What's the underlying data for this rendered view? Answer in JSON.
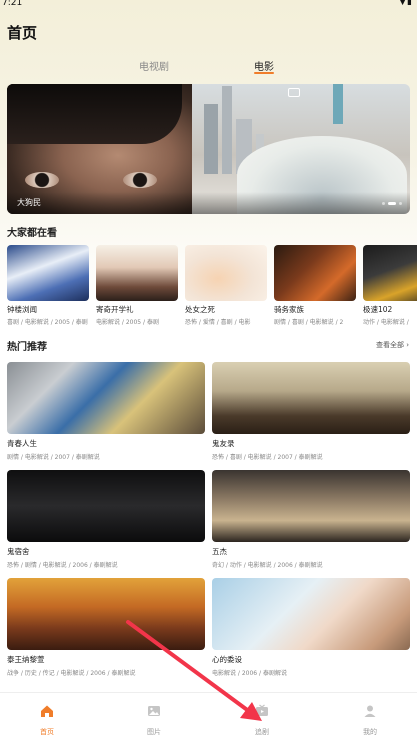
{
  "status": {
    "time": "7:21",
    "icons": "▼▮"
  },
  "page_title": "首页",
  "tabs": [
    {
      "label": "电视剧",
      "active": false
    },
    {
      "label": "电影",
      "active": true
    }
  ],
  "banner": {
    "caption": "大狗民"
  },
  "section_popular": {
    "title": "大家都在看"
  },
  "popular": [
    {
      "name": "钟楼浏闻",
      "meta": "喜剧 / 电影解说 / 2005 / 泰剧"
    },
    {
      "name": "寄奇开学礼",
      "meta": "电影解说 / 2005 / 泰剧"
    },
    {
      "name": "处女之死",
      "meta": "恐怖 / 爱情 / 喜剧 / 电影"
    },
    {
      "name": "骑务家族",
      "meta": "剧情 / 喜剧 / 电影解说 / 2"
    },
    {
      "name": "极速102",
      "meta": "动作 / 电影解说 /"
    }
  ],
  "section_hot": {
    "title": "热门推荐",
    "more": "查看全部"
  },
  "hot": [
    {
      "name": "青春人生",
      "meta": "剧情 / 电影解说 / 2007 / 泰剧解说"
    },
    {
      "name": "鬼友录",
      "meta": "恐怖 / 喜剧 / 电影解说 / 2007 / 泰剧解说"
    },
    {
      "name": "鬼宿舍",
      "meta": "恐怖 / 剧情 / 电影解说 / 2006 / 泰剧解说"
    },
    {
      "name": "五杰",
      "meta": "奇幻 / 动作 / 电影解说 / 2006 / 泰剧解说"
    },
    {
      "name": "泰王纳黎萱",
      "meta": "战争 / 历史 / 传记 / 电影解说 / 2006 / 泰剧解说"
    },
    {
      "name": "心的委设",
      "meta": "电影解说 / 2006 / 泰剧解说"
    }
  ],
  "nav": [
    {
      "label": "首页",
      "icon": "home-icon",
      "active": true
    },
    {
      "label": "图片",
      "icon": "image-icon",
      "active": false
    },
    {
      "label": "追剧",
      "icon": "tv-icon",
      "active": false
    },
    {
      "label": "我的",
      "icon": "user-icon",
      "active": false
    }
  ],
  "colors": {
    "accent": "#f07d2a",
    "annotation_arrow": "#f2354a"
  }
}
